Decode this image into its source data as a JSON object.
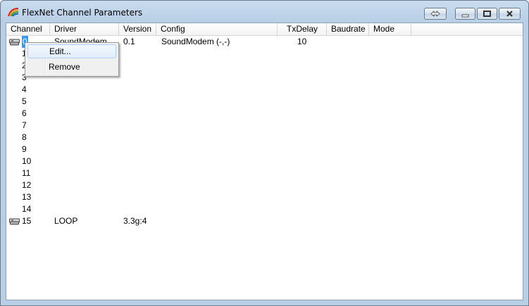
{
  "window": {
    "title": "FlexNet Channel Parameters"
  },
  "columns": [
    "Channel",
    "Driver",
    "Version",
    "Config",
    "TxDelay",
    "Baudrate",
    "Mode"
  ],
  "rows": [
    {
      "channel": "0",
      "driver": "SoundModem",
      "version": "0.1",
      "config": "SoundModem (-,-)",
      "txdelay": "10",
      "has_icon": true,
      "selected": true
    },
    {
      "channel": "1",
      "driver": "",
      "version": "",
      "config": "",
      "txdelay": ""
    },
    {
      "channel": "2",
      "driver": "",
      "version": "",
      "config": "",
      "txdelay": ""
    },
    {
      "channel": "3",
      "driver": "",
      "version": "",
      "config": "",
      "txdelay": ""
    },
    {
      "channel": "4",
      "driver": "",
      "version": "",
      "config": "",
      "txdelay": ""
    },
    {
      "channel": "5",
      "driver": "",
      "version": "",
      "config": "",
      "txdelay": ""
    },
    {
      "channel": "6",
      "driver": "",
      "version": "",
      "config": "",
      "txdelay": ""
    },
    {
      "channel": "7",
      "driver": "",
      "version": "",
      "config": "",
      "txdelay": ""
    },
    {
      "channel": "8",
      "driver": "",
      "version": "",
      "config": "",
      "txdelay": ""
    },
    {
      "channel": "9",
      "driver": "",
      "version": "",
      "config": "",
      "txdelay": ""
    },
    {
      "channel": "10",
      "driver": "",
      "version": "",
      "config": "",
      "txdelay": ""
    },
    {
      "channel": "11",
      "driver": "",
      "version": "",
      "config": "",
      "txdelay": ""
    },
    {
      "channel": "12",
      "driver": "",
      "version": "",
      "config": "",
      "txdelay": ""
    },
    {
      "channel": "13",
      "driver": "",
      "version": "",
      "config": "",
      "txdelay": ""
    },
    {
      "channel": "14",
      "driver": "",
      "version": "",
      "config": "",
      "txdelay": ""
    },
    {
      "channel": "15",
      "driver": "LOOP",
      "version": "3.3g:4",
      "config": "",
      "txdelay": "",
      "has_icon": true
    }
  ],
  "context_menu": {
    "items": [
      "Edit...",
      "Remove"
    ]
  },
  "icons": {
    "app": "rainbow-icon",
    "channel": "modem-icon",
    "restore": "double-arrow-icon",
    "minimize": "minimize-icon",
    "maximize": "maximize-icon",
    "close": "close-icon"
  },
  "colors": {
    "selection": "#3399ff",
    "titlebar": "#b9cfe6"
  }
}
